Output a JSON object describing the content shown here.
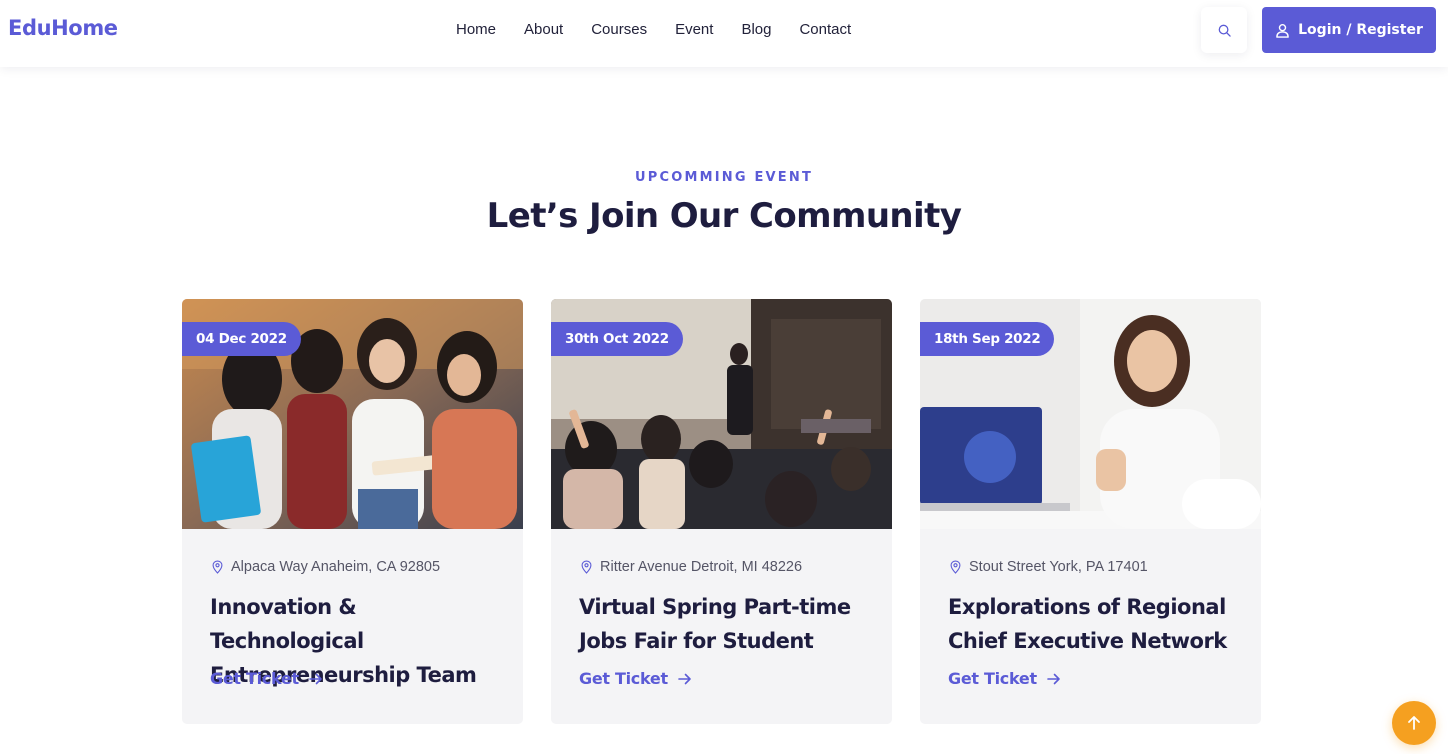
{
  "header": {
    "logo": "EduHome",
    "nav": [
      "Home",
      "About",
      "Courses",
      "Event",
      "Blog",
      "Contact"
    ],
    "search_icon": "search-icon",
    "login_label": "Login / Register",
    "login_icon": "user-icon"
  },
  "section": {
    "eyebrow": "UPCOMMING EVENT",
    "title": "Let’s Join Our Community"
  },
  "events": [
    {
      "date": "04 Dec 2022",
      "location": "Alpaca Way Anaheim, CA 92805",
      "title_line1": "Innovation & Technological",
      "title_line2": "Entrepreneurship Team",
      "link": "Get Ticket"
    },
    {
      "date": "30th Oct 2022",
      "location": "Ritter Avenue Detroit, MI 48226",
      "title_line1": "Virtual Spring Part-time",
      "title_line2": "Jobs Fair for Student",
      "link": "Get Ticket"
    },
    {
      "date": "18th Sep 2022",
      "location": "Stout Street York, PA 17401",
      "title_line1": "Explorations of Regional",
      "title_line2": "Chief Executive Network",
      "link": "Get Ticket"
    }
  ],
  "colors": {
    "brand": "#5b5bd6",
    "heading": "#1e1d3f",
    "card_bg": "#f4f4f6",
    "scroll_top": "#f5a020"
  },
  "scroll_top_icon": "arrow-up-icon"
}
